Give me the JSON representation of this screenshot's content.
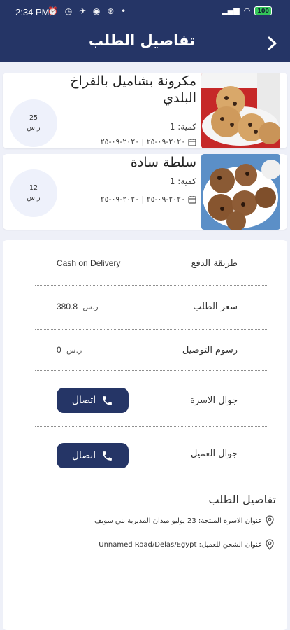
{
  "status_bar": {
    "time": "2:34 PM",
    "battery": "100"
  },
  "header": {
    "title": "تفاصيل الطلب"
  },
  "items": [
    {
      "name": "مكرونة بشاميل بالفراخ البلدي",
      "qty": "كمية: 1",
      "date": "٢٠٢٠-٠٩-٢٥ | ٢٠٢٠-٠٩-٢٥",
      "price": "25",
      "currency": "ر.س"
    },
    {
      "name": "سلطة سادة",
      "qty": "كمية: 1",
      "date": "٢٠٢٠-٠٩-٢٥ | ٢٠٢٠-٠٩-٢٥",
      "price": "12",
      "currency": "ر.س"
    }
  ],
  "details": {
    "payment_label": "طريقة الدفع",
    "payment_value": "Cash on Delivery",
    "order_price_label": "سعر الطلب",
    "order_price_value": "380.8",
    "delivery_fee_label": "رسوم التوصيل",
    "delivery_fee_value": "0",
    "currency": "ر.س",
    "family_phone_label": "جوال الاسرة",
    "customer_phone_label": "جوال العميل",
    "call_label": "اتصال"
  },
  "order_details": {
    "title": "تفاصيل الطلب",
    "family_address": "عنوان الاسرة المنتجة: 23 يوليو ميدان المديرية بني سويف",
    "shipping_address": "عنوان الشحن للعميل: Unnamed Road/Delas/Egypt"
  },
  "colors": {
    "primary": "#253566",
    "background": "#eef0f8",
    "circle": "#eef1fb"
  },
  "icons": [
    "back-arrow-icon",
    "calendar-icon",
    "phone-icon",
    "location-pin-icon"
  ]
}
